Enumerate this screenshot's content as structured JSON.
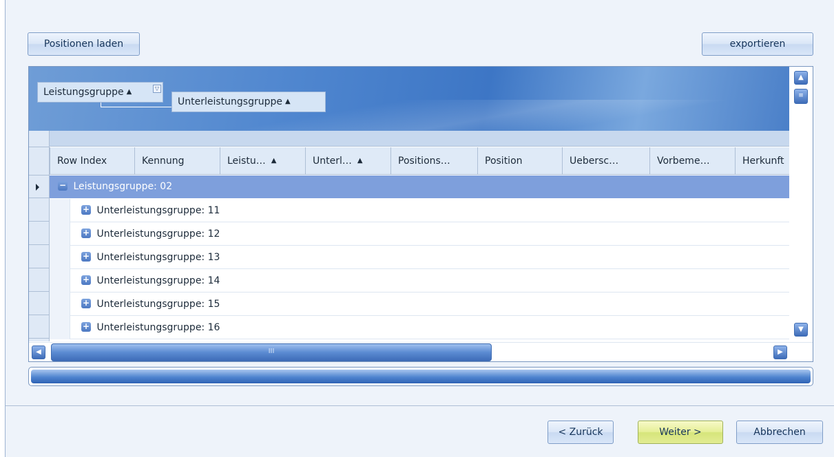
{
  "toolbar": {
    "load_label": "Positionen laden",
    "export_label": "exportieren"
  },
  "group_panel": {
    "chips": [
      {
        "label": "Leistungsgruppe",
        "sort": "▲"
      },
      {
        "label": "Unterleistungsgruppe",
        "sort": "▲"
      }
    ]
  },
  "grid": {
    "columns": [
      {
        "label": "Row Index",
        "sort": ""
      },
      {
        "label": "Kennung",
        "sort": ""
      },
      {
        "label": "Leistu…",
        "sort": "▲"
      },
      {
        "label": "Unterl…",
        "sort": "▲"
      },
      {
        "label": "Positions…",
        "sort": ""
      },
      {
        "label": "Position",
        "sort": ""
      },
      {
        "label": "Uebersc…",
        "sort": ""
      },
      {
        "label": "Vorbeme…",
        "sort": ""
      },
      {
        "label": "Herkunft",
        "sort": ""
      }
    ],
    "group_row": {
      "label": "Leistungsgruppe: 02",
      "expander": "−"
    },
    "sub_rows": [
      {
        "label": "Unterleistungsgruppe: 11",
        "expander": "+"
      },
      {
        "label": "Unterleistungsgruppe: 12",
        "expander": "+"
      },
      {
        "label": "Unterleistungsgruppe: 13",
        "expander": "+"
      },
      {
        "label": "Unterleistungsgruppe: 14",
        "expander": "+"
      },
      {
        "label": "Unterleistungsgruppe: 15",
        "expander": "+"
      },
      {
        "label": "Unterleistungsgruppe: 16",
        "expander": "+"
      }
    ],
    "hscroll_grip": "III"
  },
  "progress": {
    "value": 1.0
  },
  "footer": {
    "back_label": "< Zurück",
    "next_label": "Weiter >",
    "cancel_label": "Abbrechen"
  },
  "colors": {
    "accent": "#4f86cf",
    "group_row": "#7e9fdc",
    "next_button": "#e6ef98"
  }
}
